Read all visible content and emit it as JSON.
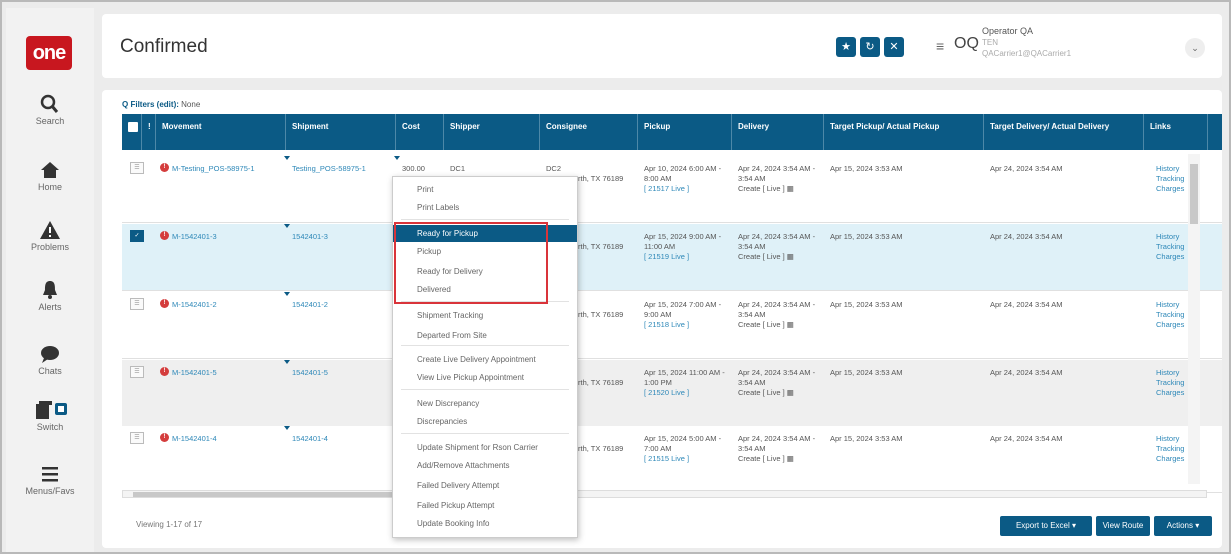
{
  "brand": {
    "logo_text": "one",
    "accent": "#0b5a85",
    "logo_color": "#c8171f"
  },
  "nav": [
    {
      "label": "Search",
      "icon": "search-icon"
    },
    {
      "label": "Home",
      "icon": "home-icon"
    },
    {
      "label": "Problems",
      "icon": "warning-icon"
    },
    {
      "label": "Alerts",
      "icon": "bell-icon"
    },
    {
      "label": "Chats",
      "icon": "chat-icon"
    },
    {
      "label": "Switch",
      "icon": "switch-icon"
    },
    {
      "label": "Menus/Favs",
      "icon": "menu-icon"
    }
  ],
  "header": {
    "title": "Confirmed",
    "initials": "OQ",
    "user_name": "Operator QA",
    "user_line2": "TEN",
    "user_line3": "QACarrier1@QACarrier1"
  },
  "filters": {
    "label": "Filters (edit):",
    "value": "None"
  },
  "columns": [
    "!",
    "Movement",
    "Shipment",
    "Cost",
    "Shipper",
    "Consignee",
    "Pickup",
    "Delivery",
    "Target Pickup/ Actual Pickup",
    "Target Delivery/ Actual Delivery",
    "Links"
  ],
  "rows": [
    {
      "movement": "M-Testing_POS-58975-1",
      "shipment": "Testing_POS-58975-1",
      "cost": "300.00",
      "shipper": "DC1",
      "consignee": "DC2",
      "consignee_city": "rth, TX 76189",
      "pickup": "Apr 10, 2024 6:00 AM - 8:00 AM",
      "pickup_live": "[ 21517 Live ]",
      "delivery": "Apr 24, 2024 3:54 AM - 3:54 AM",
      "delivery_create": "Create [ Live ]",
      "target_pickup": "Apr 15, 2024 3:53 AM",
      "target_delivery": "Apr 24, 2024 3:54 AM",
      "links": [
        "History",
        "Tracking",
        "Charges"
      ],
      "checked": false
    },
    {
      "movement": "M-1542401-3",
      "shipment": "1542401-3",
      "cost": "",
      "shipper": "",
      "consignee": "",
      "consignee_city": "rth, TX 76189",
      "pickup": "Apr 15, 2024 9:00 AM - 11:00 AM",
      "pickup_live": "[ 21519 Live ]",
      "delivery": "Apr 24, 2024 3:54 AM - 3:54 AM",
      "delivery_create": "Create [ Live ]",
      "target_pickup": "Apr 15, 2024 3:53 AM",
      "target_delivery": "Apr 24, 2024 3:54 AM",
      "links": [
        "History",
        "Tracking",
        "Charges"
      ],
      "checked": true
    },
    {
      "movement": "M-1542401-2",
      "shipment": "1542401-2",
      "cost": "",
      "shipper": "",
      "consignee": "",
      "consignee_city": "rth, TX 76189",
      "pickup": "Apr 15, 2024 7:00 AM - 9:00 AM",
      "pickup_live": "[ 21518 Live ]",
      "delivery": "Apr 24, 2024 3:54 AM - 3:54 AM",
      "delivery_create": "Create [ Live ]",
      "target_pickup": "Apr 15, 2024 3:53 AM",
      "target_delivery": "Apr 24, 2024 3:54 AM",
      "links": [
        "History",
        "Tracking",
        "Charges"
      ],
      "checked": false
    },
    {
      "movement": "M-1542401-5",
      "shipment": "1542401-5",
      "cost": "",
      "shipper": "",
      "consignee": "",
      "consignee_city": "rth, TX 76189",
      "pickup": "Apr 15, 2024 11:00 AM - 1:00 PM",
      "pickup_live": "[ 21520 Live ]",
      "delivery": "Apr 24, 2024 3:54 AM - 3:54 AM",
      "delivery_create": "Create [ Live ]",
      "target_pickup": "Apr 15, 2024 3:53 AM",
      "target_delivery": "Apr 24, 2024 3:54 AM",
      "links": [
        "History",
        "Tracking",
        "Charges"
      ],
      "checked": false
    },
    {
      "movement": "M-1542401-4",
      "shipment": "1542401-4",
      "cost": "",
      "shipper": "",
      "consignee": "",
      "consignee_city": "rth, TX 76189",
      "pickup": "Apr 15, 2024 5:00 AM - 7:00 AM",
      "pickup_live": "[ 21515 Live ]",
      "delivery": "Apr 24, 2024 3:54 AM - 3:54 AM",
      "delivery_create": "Create [ Live ]",
      "target_pickup": "Apr 15, 2024 3:53 AM",
      "target_delivery": "Apr 24, 2024 3:54 AM",
      "links": [
        "History",
        "Tracking",
        "Charges"
      ],
      "checked": false
    }
  ],
  "context_menu": [
    "Print",
    "Print Labels",
    "Ready for Pickup",
    "Pickup",
    "Ready for Delivery",
    "Delivered",
    "Shipment Tracking",
    "Departed From Site",
    "Create Live Delivery Appointment",
    "View Live Pickup Appointment",
    "New Discrepancy",
    "Discrepancies",
    "Update Shipment for Rson Carrier",
    "Add/Remove Attachments",
    "Failed Delivery Attempt",
    "Failed Pickup Attempt",
    "Update Booking Info"
  ],
  "footer": {
    "viewing": "Viewing 1-17 of 17",
    "export": "Export to Excel ▾",
    "view_route": "View Route",
    "actions": "Actions ▾"
  }
}
